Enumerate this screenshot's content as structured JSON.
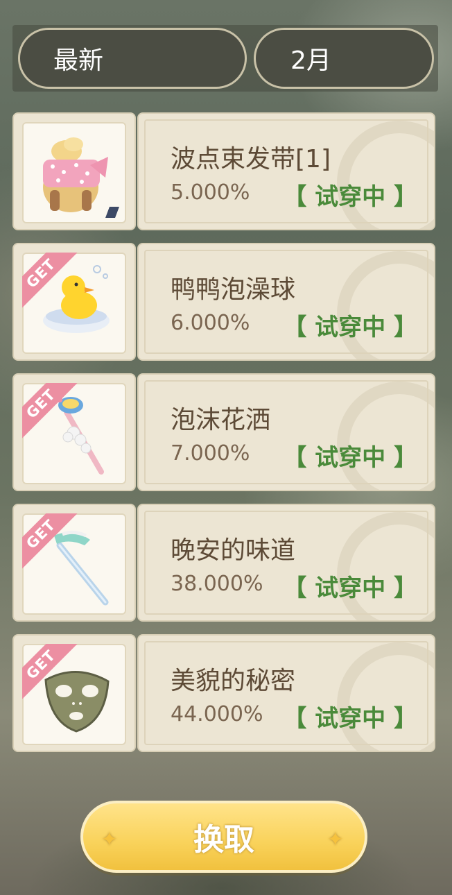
{
  "filters": {
    "sort": "最新",
    "month": "2月"
  },
  "items": [
    {
      "name": "波点束发带[1]",
      "rate": "5.000%",
      "status": "【 试穿中 】",
      "get": false,
      "icon": "polka-hairband-icon"
    },
    {
      "name": "鸭鸭泡澡球",
      "rate": "6.000%",
      "status": "【 试穿中 】",
      "get": true,
      "icon": "rubber-duck-icon"
    },
    {
      "name": "泡沫花洒",
      "rate": "7.000%",
      "status": "【 试穿中 】",
      "get": true,
      "icon": "foam-wand-icon"
    },
    {
      "name": "晚安的味道",
      "rate": "38.000%",
      "status": "【 试穿中 】",
      "get": true,
      "icon": "toothbrush-icon"
    },
    {
      "name": "美貌的秘密",
      "rate": "44.000%",
      "status": "【 试穿中 】",
      "get": true,
      "icon": "face-mask-icon"
    }
  ],
  "get_label": "GET",
  "exchange_label": "换取",
  "colors": {
    "status_green": "#4a8a3a",
    "get_ribbon": "#ec8fa2",
    "button_yellow": "#f9d25a"
  }
}
